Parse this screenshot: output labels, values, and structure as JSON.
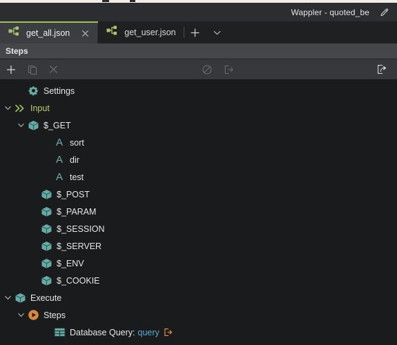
{
  "window": {
    "title": "Wappler - quoted_be",
    "edit_icon": "pencil-icon"
  },
  "tabs": {
    "items": [
      {
        "label": "get_all.json",
        "icon": "flow-node-icon",
        "active": true,
        "closable": true
      },
      {
        "label": "get_user.json",
        "icon": "flow-node-icon",
        "active": false,
        "closable": false
      }
    ],
    "new_tab_icon": "plus-icon",
    "more_tabs_icon": "chevron-down-icon"
  },
  "panel": {
    "header_title": "Steps"
  },
  "toolbar": {
    "left": [
      {
        "name": "add-step-button",
        "icon": "plus-icon",
        "enabled": true
      },
      {
        "name": "duplicate-step-button",
        "icon": "copy-icon",
        "enabled": false
      },
      {
        "name": "delete-step-button",
        "icon": "close-x-icon",
        "enabled": false
      }
    ],
    "middle": [
      {
        "name": "disable-step-button",
        "icon": "circle-slash-icon",
        "enabled": false
      },
      {
        "name": "move-out-button",
        "icon": "exit-arrow-icon",
        "enabled": false
      }
    ],
    "right": [
      {
        "name": "share-export-button",
        "icon": "share-arrow-icon",
        "enabled": true
      }
    ]
  },
  "tree": {
    "items": [
      {
        "label": "Settings",
        "icon": "gear-icon",
        "indent": 1,
        "twisty": "none",
        "style": "normal"
      },
      {
        "label": "Input",
        "icon": "chevrons-icon",
        "indent": 0,
        "twisty": "expanded",
        "style": "green"
      },
      {
        "label": "$_GET",
        "icon": "cube-icon",
        "indent": 1,
        "twisty": "expanded",
        "style": "normal"
      },
      {
        "label": "sort",
        "icon": "letter-a-icon",
        "indent": 3,
        "twisty": "none",
        "style": "normal"
      },
      {
        "label": "dir",
        "icon": "letter-a-icon",
        "indent": 3,
        "twisty": "none",
        "style": "normal"
      },
      {
        "label": "test",
        "icon": "letter-a-icon",
        "indent": 3,
        "twisty": "none",
        "style": "normal"
      },
      {
        "label": "$_POST",
        "icon": "cube-icon",
        "indent": 2,
        "twisty": "none",
        "style": "normal"
      },
      {
        "label": "$_PARAM",
        "icon": "cube-icon",
        "indent": 2,
        "twisty": "none",
        "style": "normal"
      },
      {
        "label": "$_SESSION",
        "icon": "cube-icon",
        "indent": 2,
        "twisty": "none",
        "style": "normal"
      },
      {
        "label": "$_SERVER",
        "icon": "cube-icon",
        "indent": 2,
        "twisty": "none",
        "style": "normal"
      },
      {
        "label": "$_ENV",
        "icon": "cube-icon",
        "indent": 2,
        "twisty": "none",
        "style": "normal"
      },
      {
        "label": "$_COOKIE",
        "icon": "cube-icon",
        "indent": 2,
        "twisty": "none",
        "style": "normal"
      },
      {
        "label": "Execute",
        "icon": "cube-icon",
        "indent": 0,
        "twisty": "expanded",
        "style": "normal"
      },
      {
        "label": "Steps",
        "icon": "play-circle-icon",
        "indent": 1,
        "twisty": "expanded",
        "style": "normal"
      },
      {
        "label": "Database Query:",
        "sub": "query",
        "trail_icon": "exit-arrow-orange-icon",
        "icon": "table-icon",
        "indent": 3,
        "twisty": "none",
        "style": "normal"
      }
    ]
  },
  "colors": {
    "accent_green": "#a3c05a",
    "teal_icon": "#69aaa5",
    "orange_icon": "#d9873f",
    "link_blue": "#5aa9d6",
    "tree_bg": "#1a1b1d",
    "toolbar_bg": "#36383b",
    "header_bg": "#454649",
    "titlebar_bg": "#2b2d30"
  }
}
